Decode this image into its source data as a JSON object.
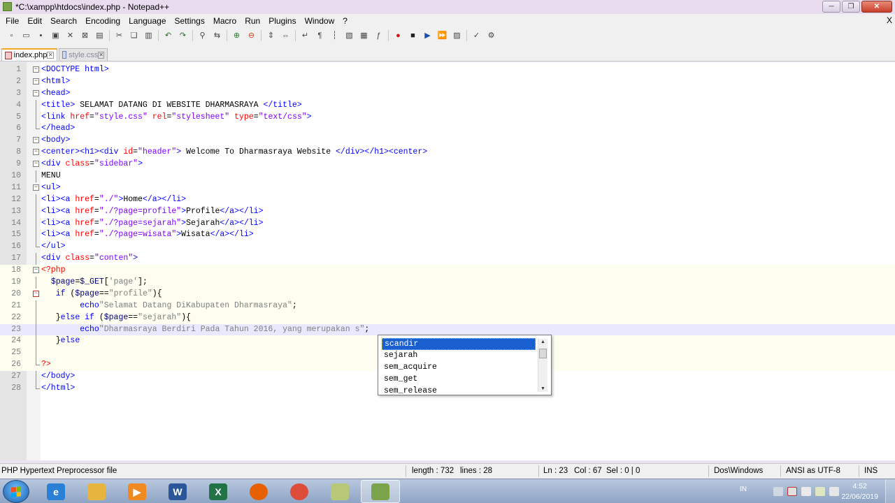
{
  "window": {
    "title": "*C:\\xampp\\htdocs\\index.php - Notepad++",
    "controls": {
      "minimize": "─",
      "maximize": "❐",
      "close": "✕"
    }
  },
  "menu": {
    "items": [
      "File",
      "Edit",
      "Search",
      "Encoding",
      "Language",
      "Settings",
      "Macro",
      "Run",
      "Plugins",
      "Window",
      "?"
    ],
    "close_doc": "X"
  },
  "toolbar": {
    "groups": [
      [
        "new-file-icon",
        "open-file-icon",
        "save-icon",
        "save-all-icon",
        "close-icon",
        "close-all-icon",
        "print-icon"
      ],
      [
        "cut-icon",
        "copy-icon",
        "paste-icon"
      ],
      [
        "undo-icon",
        "redo-icon"
      ],
      [
        "find-icon",
        "replace-icon"
      ],
      [
        "zoom-in-icon",
        "zoom-out-icon"
      ],
      [
        "sync-vertical-icon",
        "sync-horizontal-icon"
      ],
      [
        "word-wrap-icon",
        "show-all-chars-icon",
        "indent-guide-icon",
        "user-lang-icon",
        "doc-map-icon",
        "function-list-icon"
      ],
      [
        "record-macro-icon",
        "stop-record-icon",
        "play-macro-icon",
        "run-macro-multiple-icon",
        "save-macro-icon"
      ],
      [
        "spellcheck-icon",
        "plugin-icon"
      ]
    ]
  },
  "tabs": [
    {
      "label": "index.php",
      "active": true
    },
    {
      "label": "style.css",
      "active": false
    }
  ],
  "editor": {
    "current_line": 23,
    "lines": [
      {
        "n": "1",
        "fold": "minus",
        "tokens": [
          [
            "t-tag",
            "<DOCTYPE html>"
          ]
        ]
      },
      {
        "n": "2",
        "fold": "minus",
        "tokens": [
          [
            "t-tag",
            "<html>"
          ]
        ]
      },
      {
        "n": "3",
        "fold": "minus",
        "tokens": [
          [
            "t-tag",
            "<head>"
          ]
        ]
      },
      {
        "n": "4",
        "fold": "line",
        "tokens": [
          [
            "t-tag",
            "<title>"
          ],
          [
            "t-blk",
            " SELAMAT DATANG DI WEBSITE DHARMASRAYA "
          ],
          [
            "t-tag",
            "</title>"
          ]
        ]
      },
      {
        "n": "5",
        "fold": "line",
        "tokens": [
          [
            "t-tag",
            "<link "
          ],
          [
            "t-attr",
            "href"
          ],
          [
            "t-blk",
            "="
          ],
          [
            "t-val",
            "\"style.css\""
          ],
          [
            "t-blk",
            " "
          ],
          [
            "t-attr",
            "rel"
          ],
          [
            "t-blk",
            "="
          ],
          [
            "t-val",
            "\"stylesheet\""
          ],
          [
            "t-blk",
            " "
          ],
          [
            "t-attr",
            "type"
          ],
          [
            "t-blk",
            "="
          ],
          [
            "t-val",
            "\"text/css\""
          ],
          [
            "t-tag",
            ">"
          ]
        ]
      },
      {
        "n": "6",
        "fold": "end",
        "tokens": [
          [
            "t-tag",
            "</head>"
          ]
        ]
      },
      {
        "n": "7",
        "fold": "minus",
        "tokens": [
          [
            "t-tag",
            "<body>"
          ]
        ]
      },
      {
        "n": "8",
        "fold": "minus",
        "tokens": [
          [
            "t-tag",
            "<center><h1><div "
          ],
          [
            "t-attr",
            "id"
          ],
          [
            "t-blk",
            "="
          ],
          [
            "t-val",
            "\"header\""
          ],
          [
            "t-tag",
            ">"
          ],
          [
            "t-blk",
            " Welcome To Dharmasraya Website "
          ],
          [
            "t-tag",
            "</div></h1><center>"
          ]
        ]
      },
      {
        "n": "9",
        "fold": "minus",
        "tokens": [
          [
            "t-tag",
            "<div "
          ],
          [
            "t-attr",
            "class"
          ],
          [
            "t-blk",
            "="
          ],
          [
            "t-val",
            "\"sidebar\""
          ],
          [
            "t-tag",
            ">"
          ]
        ]
      },
      {
        "n": "10",
        "fold": "line",
        "tokens": [
          [
            "t-blk",
            "MENU"
          ]
        ]
      },
      {
        "n": "11",
        "fold": "minus",
        "tokens": [
          [
            "t-tag",
            "<ul>"
          ]
        ]
      },
      {
        "n": "12",
        "fold": "line",
        "tokens": [
          [
            "t-tag",
            "<li><a "
          ],
          [
            "t-attr",
            "href"
          ],
          [
            "t-blk",
            "="
          ],
          [
            "t-val",
            "\"./\""
          ],
          [
            "t-tag",
            ">"
          ],
          [
            "t-blk",
            "Home"
          ],
          [
            "t-tag",
            "</a></li>"
          ]
        ]
      },
      {
        "n": "13",
        "fold": "line",
        "tokens": [
          [
            "t-tag",
            "<li><a "
          ],
          [
            "t-attr",
            "href"
          ],
          [
            "t-blk",
            "="
          ],
          [
            "t-val",
            "\"./?page=profile\""
          ],
          [
            "t-tag",
            ">"
          ],
          [
            "t-blk",
            "Profile"
          ],
          [
            "t-tag",
            "</a></li>"
          ]
        ]
      },
      {
        "n": "14",
        "fold": "line",
        "tokens": [
          [
            "t-tag",
            "<li><a "
          ],
          [
            "t-attr",
            "href"
          ],
          [
            "t-blk",
            "="
          ],
          [
            "t-val",
            "\"./?page=sejarah\""
          ],
          [
            "t-tag",
            ">"
          ],
          [
            "t-blk",
            "Sejarah"
          ],
          [
            "t-tag",
            "</a></li>"
          ]
        ]
      },
      {
        "n": "15",
        "fold": "line",
        "tokens": [
          [
            "t-tag",
            "<li><a "
          ],
          [
            "t-attr",
            "href"
          ],
          [
            "t-blk",
            "="
          ],
          [
            "t-val",
            "\"./?page=wisata\""
          ],
          [
            "t-tag",
            ">"
          ],
          [
            "t-blk",
            "Wisata"
          ],
          [
            "t-tag",
            "</a></li>"
          ]
        ]
      },
      {
        "n": "16",
        "fold": "end",
        "tokens": [
          [
            "t-tag",
            "</ul>"
          ]
        ]
      },
      {
        "n": "17",
        "fold": "line",
        "tokens": [
          [
            "t-tag",
            "<div "
          ],
          [
            "t-attr",
            "class"
          ],
          [
            "t-blk",
            "="
          ],
          [
            "t-val",
            "\"conten\""
          ],
          [
            "t-tag",
            ">"
          ]
        ]
      },
      {
        "n": "18",
        "fold": "minus",
        "php": true,
        "tokens": [
          [
            "t-php",
            "<?php"
          ]
        ]
      },
      {
        "n": "19",
        "fold": "line",
        "php": true,
        "tokens": [
          [
            "t-blk",
            "  "
          ],
          [
            "t-var",
            "$page"
          ],
          [
            "t-blk",
            "="
          ],
          [
            "t-var",
            "$_GET"
          ],
          [
            "t-blk",
            "["
          ],
          [
            "t-str",
            "'page'"
          ],
          [
            "t-blk",
            "];"
          ]
        ]
      },
      {
        "n": "20",
        "fold": "red",
        "php": true,
        "tokens": [
          [
            "t-blk",
            "   "
          ],
          [
            "t-kw",
            "if"
          ],
          [
            "t-blk",
            " ("
          ],
          [
            "t-var",
            "$page"
          ],
          [
            "t-blk",
            "=="
          ],
          [
            "t-str",
            "\"profile\""
          ],
          [
            "t-blk",
            "){"
          ]
        ]
      },
      {
        "n": "21",
        "fold": "line",
        "php": true,
        "tokens": [
          [
            "t-blk",
            "        "
          ],
          [
            "t-kw",
            "echo"
          ],
          [
            "t-str",
            "\"Selamat Datang DiKabupaten Dharmasraya\""
          ],
          [
            "t-blk",
            ";"
          ]
        ]
      },
      {
        "n": "22",
        "fold": "line",
        "php": true,
        "tokens": [
          [
            "t-blk",
            "   "
          ],
          [
            "t-blk",
            "}"
          ],
          [
            "t-kw",
            "else if"
          ],
          [
            "t-blk",
            " ("
          ],
          [
            "t-var",
            "$page"
          ],
          [
            "t-blk",
            "=="
          ],
          [
            "t-str",
            "\"sejarah\""
          ],
          [
            "t-blk",
            "){"
          ]
        ]
      },
      {
        "n": "23",
        "fold": "line",
        "php": true,
        "tokens": [
          [
            "t-blk",
            "        "
          ],
          [
            "t-kw",
            "echo"
          ],
          [
            "t-str",
            "\"Dharmasraya Berdiri Pada Tahun 2016, yang merupakan s\""
          ],
          [
            "t-blk",
            ";"
          ]
        ]
      },
      {
        "n": "24",
        "fold": "line",
        "php": true,
        "tokens": [
          [
            "t-blk",
            "   "
          ],
          [
            "t-blk",
            "}"
          ],
          [
            "t-kw",
            "else"
          ]
        ]
      },
      {
        "n": "25",
        "fold": "line",
        "php": true,
        "tokens": []
      },
      {
        "n": "26",
        "fold": "end",
        "php": true,
        "tokens": [
          [
            "t-php",
            "?>"
          ]
        ]
      },
      {
        "n": "27",
        "fold": "line",
        "tokens": [
          [
            "t-tag",
            "</body>"
          ]
        ]
      },
      {
        "n": "28",
        "fold": "end",
        "tokens": [
          [
            "t-tag",
            "</html>"
          ]
        ]
      }
    ]
  },
  "autocomplete": {
    "items": [
      "scandir",
      "sejarah",
      "sem_acquire",
      "sem_get",
      "sem_release"
    ],
    "selected_index": 0
  },
  "statusbar": {
    "filetype": "PHP Hypertext Preprocessor file",
    "length": "length : 732",
    "lines": "lines : 28",
    "ln": "Ln : 23",
    "col": "Col : 67",
    "sel": "Sel : 0 | 0",
    "eol": "Dos\\Windows",
    "encoding": "ANSI as UTF-8",
    "mode": "INS"
  },
  "taskbar": {
    "apps": [
      {
        "name": "internet-explorer",
        "label": "e",
        "color": "#2a7fd6"
      },
      {
        "name": "file-explorer",
        "label": "",
        "color": "#e8b440"
      },
      {
        "name": "media-player",
        "label": "▶",
        "color": "#f08a20"
      },
      {
        "name": "word",
        "label": "W",
        "color": "#2b579a"
      },
      {
        "name": "excel",
        "label": "X",
        "color": "#217346"
      },
      {
        "name": "firefox",
        "label": "",
        "color": "#e66000"
      },
      {
        "name": "chrome",
        "label": "",
        "color": "#dd4b39"
      },
      {
        "name": "stickies",
        "label": "",
        "color": "#b8c878"
      },
      {
        "name": "notepad-plus-plus",
        "label": "",
        "color": "#7aa34b"
      }
    ],
    "lang": "IN",
    "time": "4:52",
    "date": "22/06/2019"
  }
}
